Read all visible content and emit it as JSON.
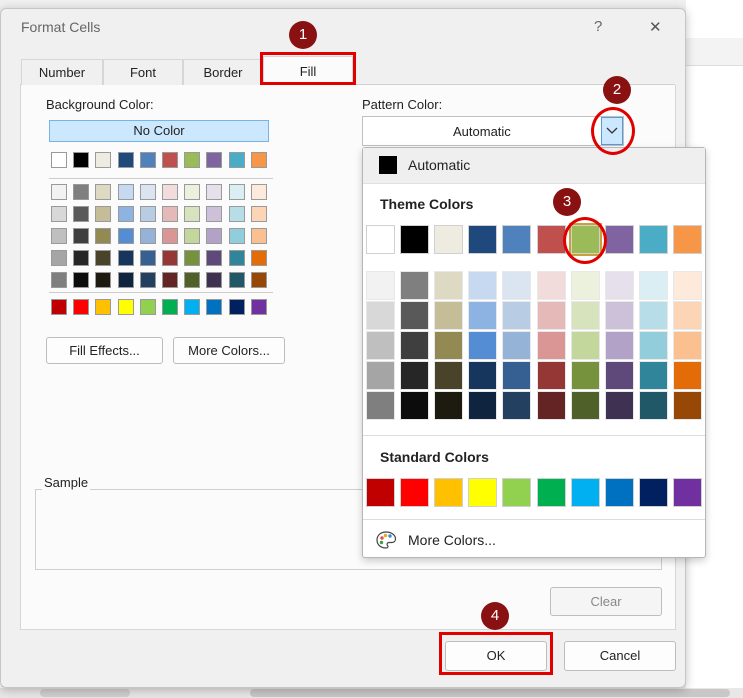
{
  "dialog": {
    "title": "Format Cells",
    "help_label": "?",
    "close_label": "✕",
    "tabs": [
      "Number",
      "Font",
      "Border",
      "Fill"
    ],
    "active_tab": "Fill"
  },
  "fill": {
    "background_label": "Background Color:",
    "no_color_label": "No Color",
    "pattern_color_label": "Pattern Color:",
    "pattern_value": "Automatic",
    "fill_effects_label": "Fill Effects...",
    "more_colors_label": "More Colors...",
    "sample_label": "Sample",
    "clear_label": "Clear"
  },
  "buttons": {
    "ok": "OK",
    "cancel": "Cancel"
  },
  "dropdown": {
    "automatic_label": "Automatic",
    "theme_title": "Theme Colors",
    "standard_title": "Standard Colors",
    "more_colors_label": "More Colors...",
    "selected_theme_color": "#9bbb59"
  },
  "palette": {
    "theme": [
      "#ffffff",
      "#000000",
      "#eeece1",
      "#1f497d",
      "#4f81bd",
      "#c0504d",
      "#9bbb59",
      "#8064a2",
      "#4bacc6",
      "#f79646"
    ],
    "shades": [
      [
        "#f2f2f2",
        "#7f7f7f",
        "#ddd9c3",
        "#c6d9f0",
        "#dbe5f1",
        "#f2dcdb",
        "#ebf1dd",
        "#e5e0ec",
        "#dbeef3",
        "#fdeada"
      ],
      [
        "#d8d8d8",
        "#595959",
        "#c4bd97",
        "#8db3e2",
        "#b8cce4",
        "#e5b9b7",
        "#d7e3bc",
        "#ccc1d9",
        "#b7dde8",
        "#fbd5b5"
      ],
      [
        "#bfbfbf",
        "#3f3f3f",
        "#938953",
        "#548dd4",
        "#95b3d7",
        "#d99694",
        "#c3d69b",
        "#b2a2c7",
        "#92cddc",
        "#fac08f"
      ],
      [
        "#a5a5a5",
        "#262626",
        "#494429",
        "#17365d",
        "#366092",
        "#953734",
        "#76923c",
        "#5f497a",
        "#31859b",
        "#e36c09"
      ],
      [
        "#7f7f7f",
        "#0c0c0c",
        "#1d1b10",
        "#0f243e",
        "#244061",
        "#632423",
        "#4f6128",
        "#3f3151",
        "#205867",
        "#974806"
      ]
    ],
    "standard": [
      "#c00000",
      "#ff0000",
      "#ffc000",
      "#ffff00",
      "#92d050",
      "#00b050",
      "#00b0f0",
      "#0070c0",
      "#002060",
      "#7030a0"
    ]
  },
  "background_rows": [
    "1",
    "1",
    "1",
    "1",
    "1",
    "1"
  ],
  "annotations": [
    "1",
    "2",
    "3",
    "4"
  ]
}
